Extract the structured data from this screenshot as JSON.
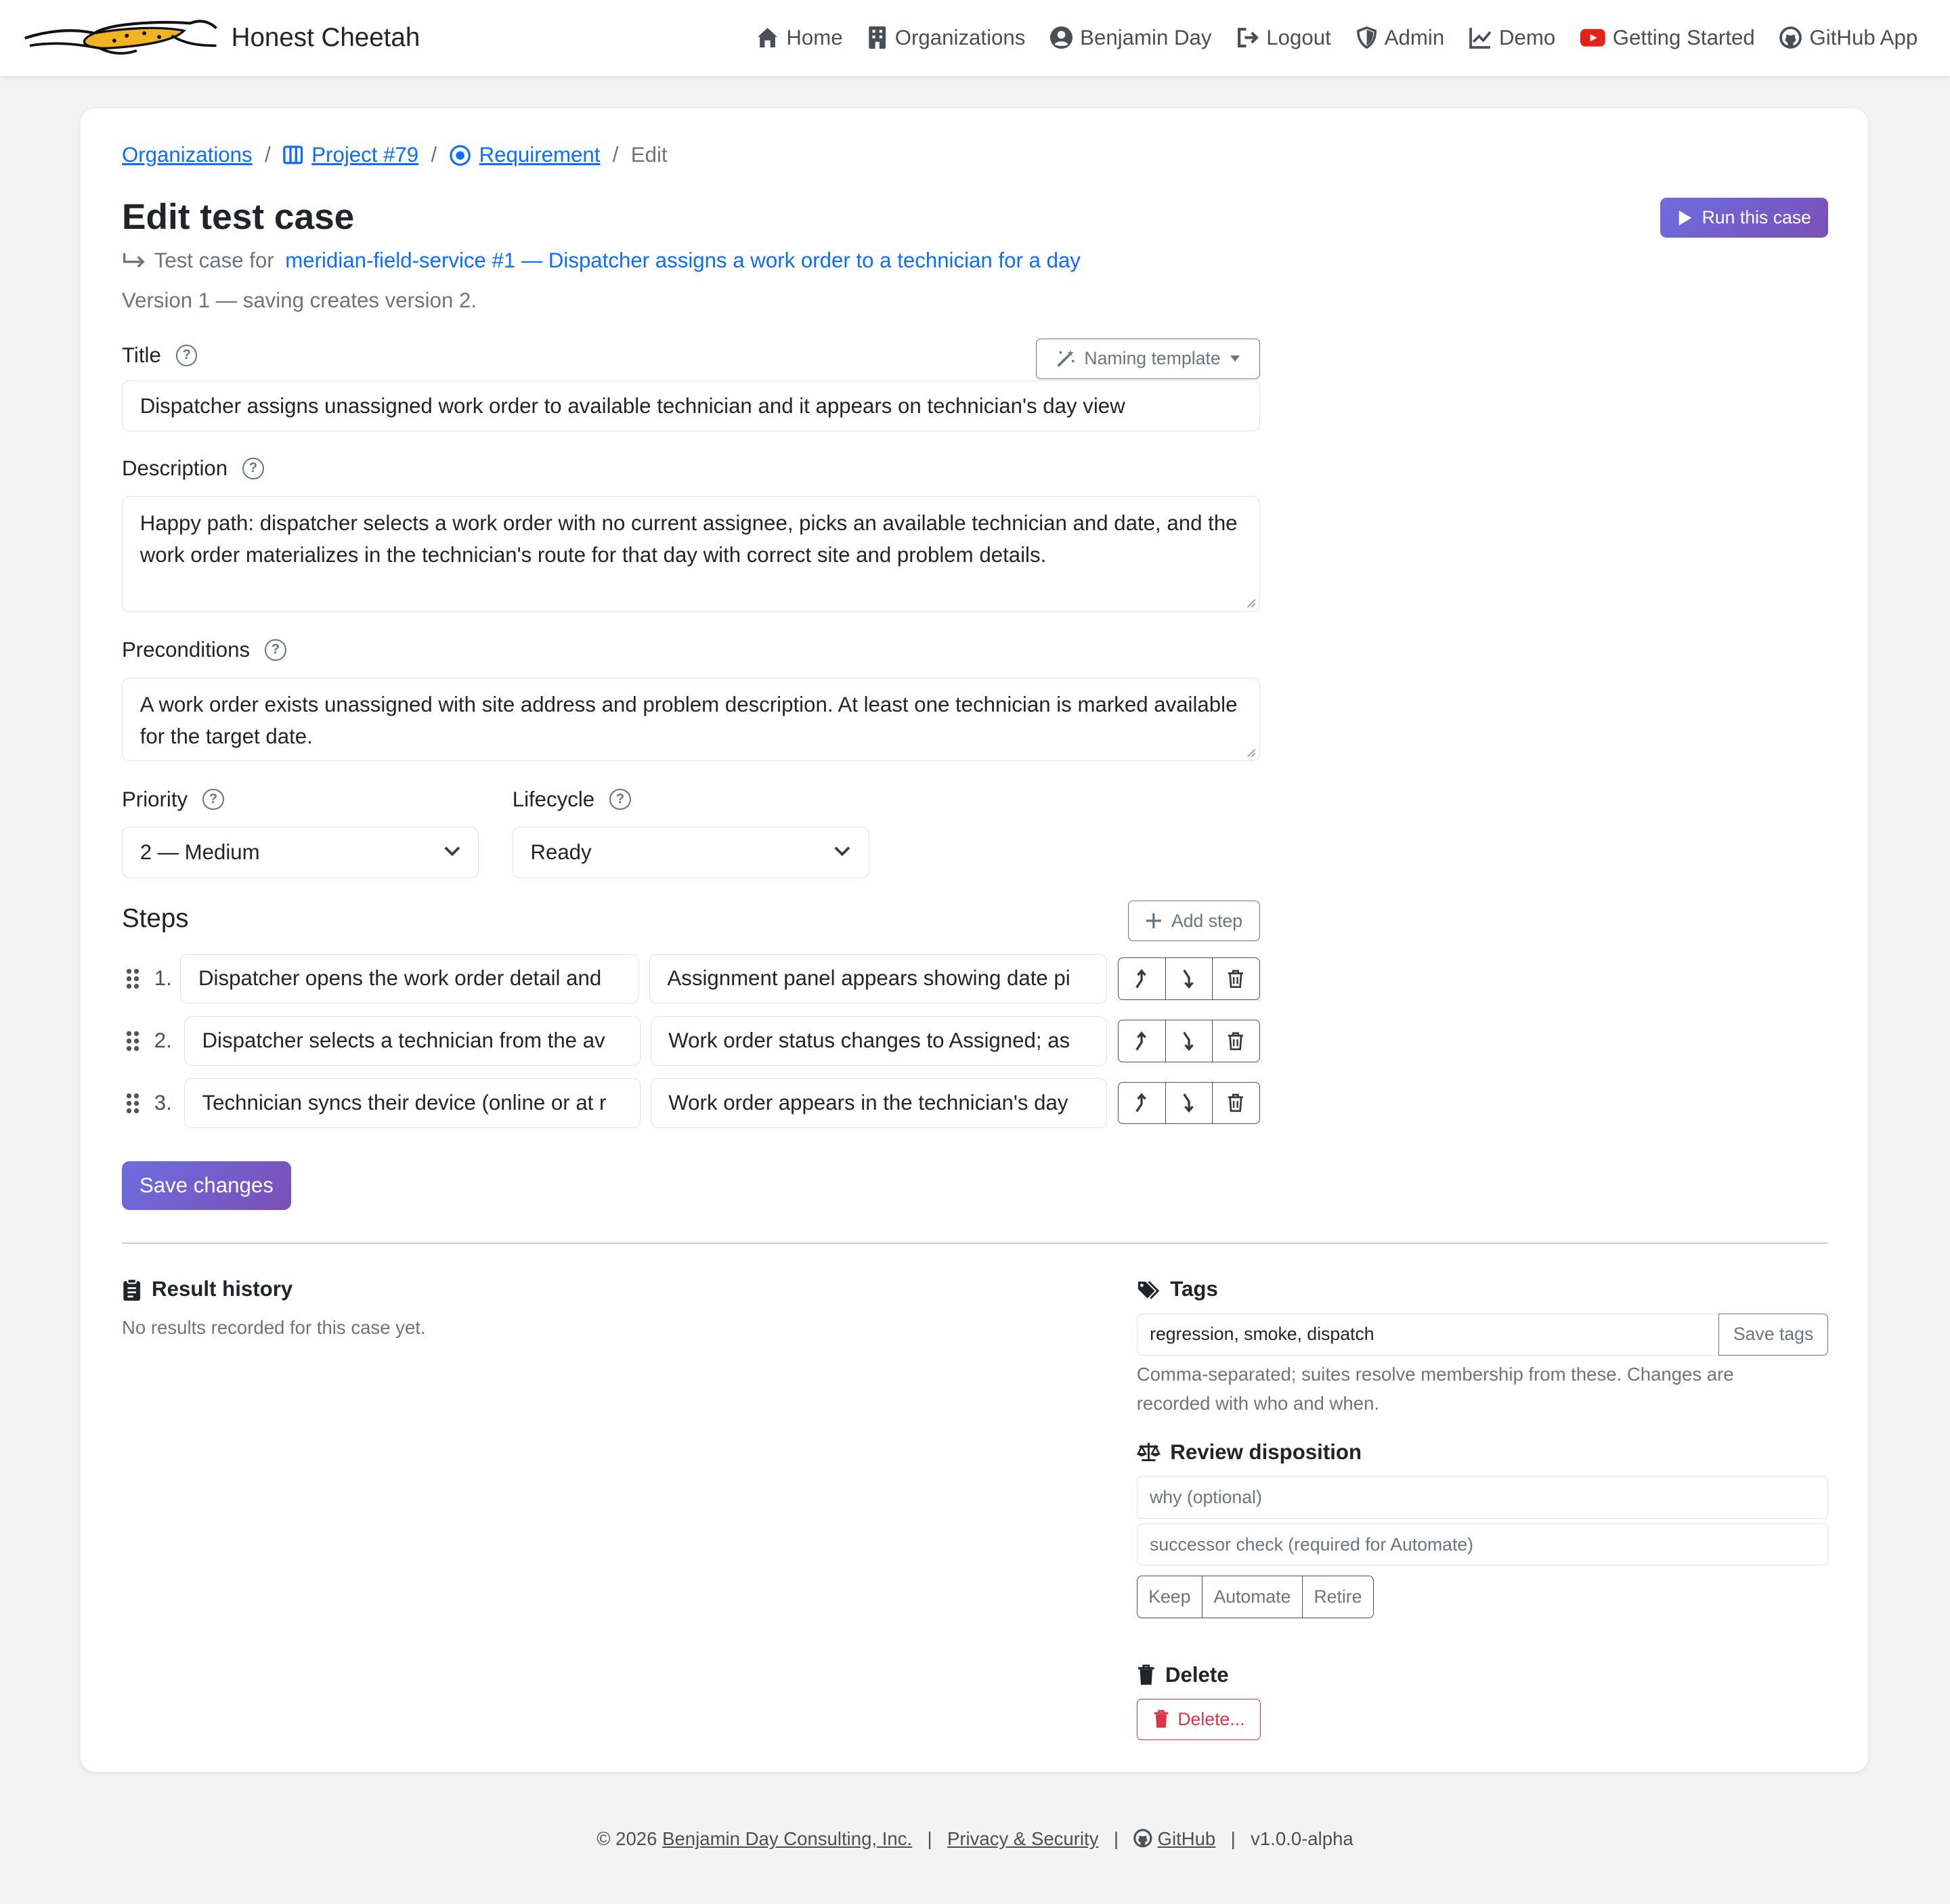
{
  "navbar": {
    "brand": "Honest Cheetah",
    "links": [
      {
        "label": "Home",
        "icon": "house-icon"
      },
      {
        "label": "Organizations",
        "icon": "building-icon"
      },
      {
        "label": "Benjamin Day",
        "icon": "person-circle-icon"
      },
      {
        "label": "Logout",
        "icon": "box-arrow-right-icon"
      },
      {
        "label": "Admin",
        "icon": "shield-icon"
      },
      {
        "label": "Demo",
        "icon": "graph-up-icon"
      },
      {
        "label": "Getting Started",
        "icon": "youtube-icon"
      },
      {
        "label": "GitHub App",
        "icon": "github-icon"
      }
    ]
  },
  "breadcrumb": {
    "organizations": "Organizations",
    "project": "Project #79",
    "requirement": "Requirement",
    "current": "Edit"
  },
  "page": {
    "title": "Edit test case",
    "run_button": "Run this case",
    "test_for_prefix": "Test case for",
    "test_for_link": "meridian-field-service #1 — Dispatcher assigns a work order to a technician for a day",
    "version_note": "Version 1 — saving creates version 2."
  },
  "form": {
    "title_label": "Title",
    "naming_template": "Naming template",
    "title_value": "Dispatcher assigns unassigned work order to available technician and it appears on technician's day view",
    "description_label": "Description",
    "description_value": "Happy path: dispatcher selects a work order with no current assignee, picks an available technician and date, and the work order materializes in the technician's route for that day with correct site and problem details.",
    "preconditions_label": "Preconditions",
    "preconditions_value": "A work order exists unassigned with site address and problem description. At least one technician is marked available for the target date.",
    "priority_label": "Priority",
    "priority_value": "2 — Medium",
    "lifecycle_label": "Lifecycle",
    "lifecycle_value": "Ready"
  },
  "steps": {
    "title": "Steps",
    "add_button": "Add step",
    "items": [
      {
        "num": "1.",
        "action": "Dispatcher opens the work order detail and",
        "expected": "Assignment panel appears showing date pi"
      },
      {
        "num": "2.",
        "action": "Dispatcher selects a technician from the av",
        "expected": "Work order status changes to Assigned; as"
      },
      {
        "num": "3.",
        "action": "Technician syncs their device (online or at r",
        "expected": "Work order appears in the technician's day"
      }
    ]
  },
  "save_button": "Save changes",
  "result_history": {
    "title": "Result history",
    "empty": "No results recorded for this case yet."
  },
  "tags": {
    "title": "Tags",
    "value": "regression, smoke, dispatch",
    "save_button": "Save tags",
    "help": "Comma-separated; suites resolve membership from these. Changes are recorded with who and when."
  },
  "review": {
    "title": "Review disposition",
    "why_placeholder": "why (optional)",
    "successor_placeholder": "successor check (required for Automate)",
    "buttons": [
      "Keep",
      "Automate",
      "Retire"
    ]
  },
  "delete": {
    "title": "Delete",
    "button": "Delete..."
  },
  "footer": {
    "copyright": "© 2026",
    "company": "Benjamin Day Consulting, Inc.",
    "privacy": "Privacy & Security",
    "github": "GitHub",
    "version": "v1.0.0-alpha"
  },
  "colors": {
    "link": "#0d6efd",
    "primary_gradient_start": "#6d6de0",
    "primary_gradient_end": "#7b4fb6",
    "danger": "#dc3545",
    "youtube": "#e62117",
    "cheetah": "#f0b323"
  }
}
